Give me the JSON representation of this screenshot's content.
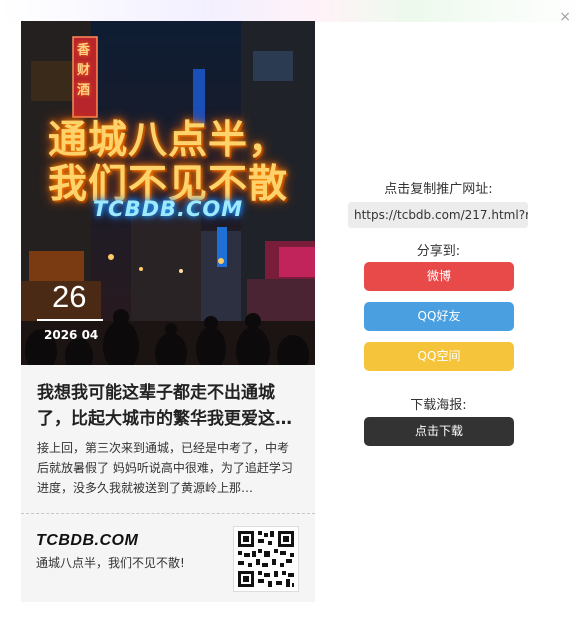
{
  "dialog": {
    "close_glyph": "×"
  },
  "poster": {
    "hero_title_line1": "通城八点半，",
    "hero_title_line2": "我们不见不散",
    "hero_brand": "TCBDB.COM",
    "sign_text": "香财酒",
    "day": "26",
    "year_month": "2026 04",
    "headline": "我想我可能这辈子都走不出通城了，比起大城市的繁华我更爱这…",
    "excerpt": "接上回，第三次来到通城，已经是中考了，中考后就放暑假了 妈妈听说高中很难，为了追赶学习进度，没多久我就被送到了黄源岭上那…",
    "footer_logo": "TCBDB.COM",
    "footer_slogan": "通城八点半，我们不见不散!"
  },
  "share_panel": {
    "copy_label": "点击复制推广网址:",
    "url": "https://tcbdb.com/217.html?r",
    "share_label": "分享到:",
    "weibo_label": "微博",
    "qq_friend_label": "QQ好友",
    "qzone_label": "QQ空间",
    "download_label": "下载海报:",
    "download_button": "点击下载"
  },
  "colors": {
    "weibo": "#e84a4a",
    "qq_friend": "#4a9fe0",
    "qzone": "#f6c43a",
    "download": "#333333"
  }
}
